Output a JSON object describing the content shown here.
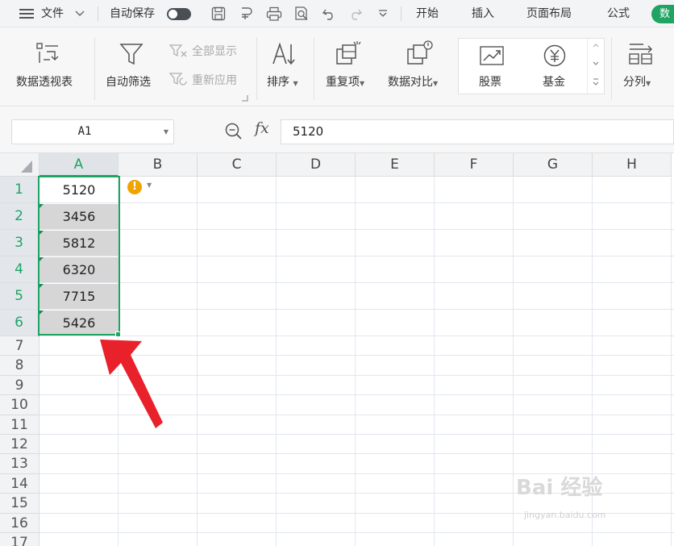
{
  "menubar": {
    "file_label": "文件",
    "autosave_label": "自动保存",
    "tabs": [
      "开始",
      "插入",
      "页面布局",
      "公式"
    ],
    "active_tab_partial": "数"
  },
  "ribbon": {
    "pivot_label": "数据透视表",
    "autofilter_label": "自动筛选",
    "show_all_label": "全部显示",
    "reapply_label": "重新应用",
    "sort_label": "排序",
    "duplicates_label": "重复项",
    "compare_label": "数据对比",
    "stock_label": "股票",
    "fund_label": "基金",
    "split_label": "分列"
  },
  "formula_bar": {
    "name_box": "A1",
    "fx_label": "fx",
    "value": "5120"
  },
  "grid": {
    "columns": [
      "A",
      "B",
      "C",
      "D",
      "E",
      "F",
      "G",
      "H"
    ],
    "rows": [
      "1",
      "2",
      "3",
      "4",
      "5",
      "6",
      "7",
      "8",
      "9",
      "10",
      "11",
      "12",
      "13",
      "14",
      "15",
      "16",
      "17"
    ],
    "cells_a": [
      "5120",
      "3456",
      "5812",
      "6320",
      "7715",
      "5426"
    ],
    "selected_column": "A",
    "selected_range": "A1:A6",
    "warning_glyph": "!"
  },
  "watermark": {
    "logo": "Bai 经验",
    "url": "jingyan.baidu.com"
  },
  "colors": {
    "accent_green": "#1fa463",
    "warning_orange": "#f0a400",
    "annotation_red": "#e8212b"
  }
}
